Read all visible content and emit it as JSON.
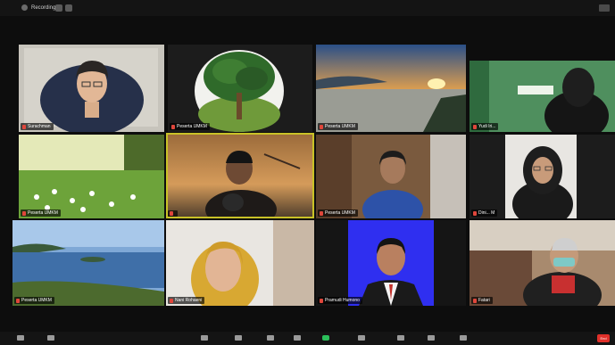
{
  "topbar": {
    "recording_label": "Recording..."
  },
  "participants": [
    "Surachman",
    "Peserta UMKM",
    "Peserta UMKM",
    "Yudi Iri...",
    "Peserta UMKM",
    "",
    "Peserta UMKM",
    "Dini... M",
    "Peserta UMKM",
    "Nani Rohaeni",
    "Pramudi Humono",
    "Fatari"
  ],
  "toolbar": {
    "end_label": "End"
  },
  "colors": {
    "active_speaker": "#c9c227",
    "mic_muted": "#e0463b",
    "end": "#e0302a"
  }
}
